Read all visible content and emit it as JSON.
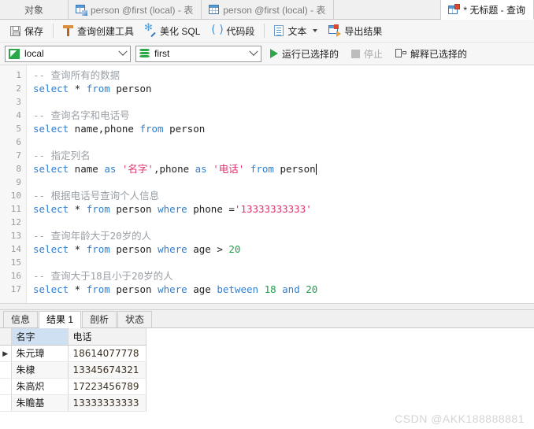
{
  "tabstrip": {
    "object_label": "对象",
    "tabs": [
      {
        "label": "person @first (local) - 表",
        "icon": "table-edit-icon",
        "active": false
      },
      {
        "label": "person @first (local) - 表",
        "icon": "table-icon",
        "active": false
      },
      {
        "label": "* 无标题 - 查询",
        "icon": "query-icon",
        "active": true
      }
    ]
  },
  "toolbar": {
    "save_label": "保存",
    "query_builder_label": "查询创建工具",
    "beautify_sql_label": "美化 SQL",
    "code_snippet_label": "代码段",
    "text_label": "文本",
    "export_result_label": "导出结果"
  },
  "toolbar2": {
    "connection_value": "local",
    "database_value": "first",
    "run_selected_label": "运行已选择的",
    "stop_label": "停止",
    "explain_selected_label": "解释已选择的"
  },
  "editor": {
    "line_numbers": [
      "1",
      "2",
      "3",
      "4",
      "5",
      "6",
      "7",
      "8",
      "9",
      "10",
      "11",
      "12",
      "13",
      "14",
      "15",
      "16",
      "17"
    ],
    "lines": [
      {
        "n": 1,
        "selected": false,
        "tokens": [
          {
            "t": "cm",
            "v": "-- 查询所有的数据"
          }
        ]
      },
      {
        "n": 2,
        "selected": false,
        "tokens": [
          {
            "t": "kw",
            "v": "select"
          },
          {
            "t": "pl",
            "v": " * "
          },
          {
            "t": "kw",
            "v": "from"
          },
          {
            "t": "pl",
            "v": " person"
          }
        ]
      },
      {
        "n": 3,
        "selected": false,
        "tokens": []
      },
      {
        "n": 4,
        "selected": false,
        "tokens": [
          {
            "t": "cm",
            "v": "-- 查询名字和电话号"
          }
        ]
      },
      {
        "n": 5,
        "selected": false,
        "tokens": [
          {
            "t": "kw",
            "v": "select"
          },
          {
            "t": "pl",
            "v": " name,phone "
          },
          {
            "t": "kw",
            "v": "from"
          },
          {
            "t": "pl",
            "v": " person"
          }
        ]
      },
      {
        "n": 6,
        "selected": false,
        "tokens": []
      },
      {
        "n": 7,
        "selected": false,
        "tokens": [
          {
            "t": "cm",
            "v": "-- 指定列名"
          }
        ]
      },
      {
        "n": 8,
        "selected": true,
        "tokens": [
          {
            "t": "kw",
            "v": "select"
          },
          {
            "t": "pl",
            "v": " name "
          },
          {
            "t": "kw",
            "v": "as"
          },
          {
            "t": "pl",
            "v": " "
          },
          {
            "t": "st",
            "v": "'名字'"
          },
          {
            "t": "pl",
            "v": ",phone "
          },
          {
            "t": "kw",
            "v": "as"
          },
          {
            "t": "pl",
            "v": " "
          },
          {
            "t": "st",
            "v": "'电话'"
          },
          {
            "t": "pl",
            "v": " "
          },
          {
            "t": "kw",
            "v": "from"
          },
          {
            "t": "pl",
            "v": " person"
          }
        ]
      },
      {
        "n": 9,
        "selected": false,
        "tokens": []
      },
      {
        "n": 10,
        "selected": false,
        "tokens": [
          {
            "t": "cm",
            "v": "-- 根据电话号查询个人信息"
          }
        ]
      },
      {
        "n": 11,
        "selected": false,
        "tokens": [
          {
            "t": "kw",
            "v": "select"
          },
          {
            "t": "pl",
            "v": " * "
          },
          {
            "t": "kw",
            "v": "from"
          },
          {
            "t": "pl",
            "v": " person "
          },
          {
            "t": "kw",
            "v": "where"
          },
          {
            "t": "pl",
            "v": " phone ="
          },
          {
            "t": "st",
            "v": "'13333333333'"
          }
        ]
      },
      {
        "n": 12,
        "selected": false,
        "tokens": []
      },
      {
        "n": 13,
        "selected": false,
        "tokens": [
          {
            "t": "cm",
            "v": "-- 查询年龄大于20岁的人"
          }
        ]
      },
      {
        "n": 14,
        "selected": false,
        "tokens": [
          {
            "t": "kw",
            "v": "select"
          },
          {
            "t": "pl",
            "v": " * "
          },
          {
            "t": "kw",
            "v": "from"
          },
          {
            "t": "pl",
            "v": " person "
          },
          {
            "t": "kw",
            "v": "where"
          },
          {
            "t": "pl",
            "v": " age > "
          },
          {
            "t": "nm",
            "v": "20"
          }
        ]
      },
      {
        "n": 15,
        "selected": false,
        "tokens": []
      },
      {
        "n": 16,
        "selected": false,
        "tokens": [
          {
            "t": "cm",
            "v": "-- 查询大于18且小于20岁的人"
          }
        ]
      },
      {
        "n": 17,
        "selected": false,
        "tokens": [
          {
            "t": "kw",
            "v": "select"
          },
          {
            "t": "pl",
            "v": " * "
          },
          {
            "t": "kw",
            "v": "from"
          },
          {
            "t": "pl",
            "v": " person "
          },
          {
            "t": "kw",
            "v": "where"
          },
          {
            "t": "pl",
            "v": " age "
          },
          {
            "t": "kw",
            "v": "between"
          },
          {
            "t": "pl",
            "v": " "
          },
          {
            "t": "nm",
            "v": "18"
          },
          {
            "t": "pl",
            "v": " "
          },
          {
            "t": "kw",
            "v": "and"
          },
          {
            "t": "pl",
            "v": " "
          },
          {
            "t": "nm",
            "v": "20"
          }
        ]
      }
    ]
  },
  "result_tabs": [
    {
      "label": "信息",
      "active": false
    },
    {
      "label": "结果 1",
      "active": true
    },
    {
      "label": "剖析",
      "active": false
    },
    {
      "label": "状态",
      "active": false
    }
  ],
  "result_grid": {
    "columns": [
      "名字",
      "电话"
    ],
    "selected_column_index": 0,
    "current_row_index": 0,
    "rows": [
      [
        "朱元璋",
        "18614077778"
      ],
      [
        "朱棣",
        "13345674321"
      ],
      [
        "朱高炽",
        "17223456789"
      ],
      [
        "朱瞻基",
        "13333333333"
      ]
    ]
  },
  "watermark": "CSDN @AKK188888881",
  "colors": {
    "keyword": "#2f7fd1",
    "comment": "#9aa0a6",
    "string": "#e0326e",
    "number": "#1f9e4a",
    "selection": "#cfe5fb",
    "accent_green": "#2aa84a",
    "accent_blue": "#3a76b8"
  }
}
